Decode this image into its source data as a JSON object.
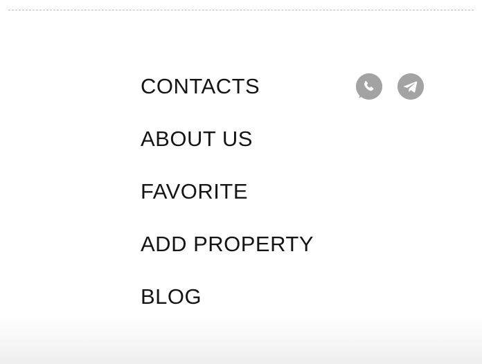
{
  "menu": {
    "items": [
      {
        "label": "CONTACTS"
      },
      {
        "label": "ABOUT US"
      },
      {
        "label": "FAVORITE"
      },
      {
        "label": "ADD PROPERTY"
      },
      {
        "label": "BLOG"
      }
    ]
  },
  "socials": {
    "icon_color": "#a3a3a3",
    "items": [
      {
        "icon": "whatsapp-icon"
      },
      {
        "icon": "telegram-icon"
      }
    ]
  }
}
